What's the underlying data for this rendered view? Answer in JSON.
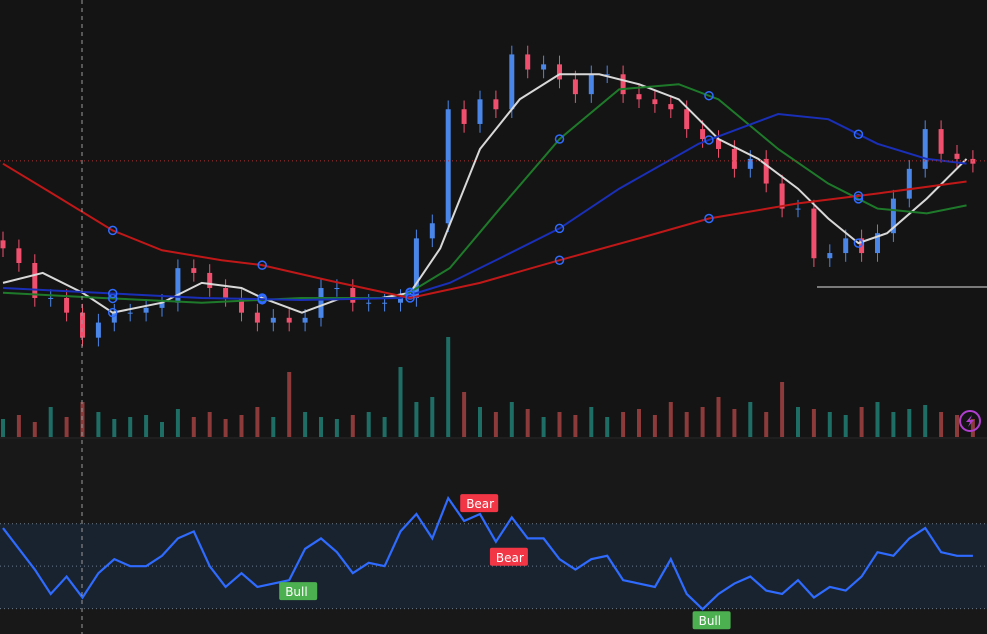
{
  "chart_data": {
    "type": "candlestick",
    "title": "",
    "price_ylim": [
      45,
      155
    ],
    "price_reference_line": 114.5,
    "closes": [
      92.5,
      88.8,
      80,
      80,
      76.3,
      70,
      73.8,
      76.3,
      76.3,
      77.5,
      78.8,
      87.5,
      86.3,
      82.5,
      80,
      76.3,
      73.8,
      75,
      73.8,
      75,
      82.5,
      82.5,
      78.8,
      78.8,
      78.8,
      80,
      95,
      98.8,
      127.5,
      123.8,
      130,
      127.5,
      141.3,
      137.5,
      138.8,
      135,
      131.3,
      136.3,
      136.3,
      131.3,
      130,
      128.8,
      127.5,
      122.5,
      120,
      117.5,
      112.5,
      115,
      108.8,
      102.5,
      102.5,
      90,
      91.3,
      95,
      91.3,
      96.3,
      105,
      112.5,
      122.5,
      116.3,
      115,
      113.8
    ],
    "volume": [
      18,
      22,
      15,
      30,
      20,
      35,
      25,
      18,
      20,
      22,
      15,
      28,
      20,
      25,
      18,
      22,
      30,
      20,
      65,
      25,
      20,
      18,
      22,
      25,
      20,
      70,
      35,
      40,
      100,
      45,
      30,
      25,
      35,
      28,
      20,
      25,
      22,
      30,
      20,
      25,
      28,
      22,
      35,
      25,
      30,
      40,
      28,
      35,
      25,
      55,
      30,
      28,
      25,
      22,
      30,
      35,
      25,
      28,
      32,
      25,
      22,
      18
    ],
    "volume_ylim": [
      0,
      100
    ],
    "moving_averages": [
      {
        "name": "MA fast",
        "color": "#d8d8d8",
        "x": [
          0,
          2.5,
          5,
          6.9,
          10,
          12.5,
          15,
          16.3,
          18.8,
          21.3,
          23.8,
          25.6,
          27.5,
          30,
          32.5,
          35,
          37.5,
          40,
          42.5,
          45,
          47.5,
          50,
          51.9,
          53.8,
          55.6,
          58.1,
          60.6
        ],
        "y": [
          83.8,
          86.3,
          81.3,
          76.3,
          78.8,
          83.8,
          82.5,
          80,
          76.3,
          80,
          80,
          81.3,
          92.5,
          117.5,
          130,
          136.3,
          136.3,
          133.8,
          130,
          120,
          115,
          107.5,
          100,
          93.8,
          96.3,
          105,
          115
        ],
        "markers": [
          6.9,
          16.3,
          25.6,
          53.8
        ]
      },
      {
        "name": "MA mid",
        "color": "#1e7a2a",
        "x": [
          0,
          6.25,
          12.5,
          18.75,
          25,
          28.1,
          31.25,
          35,
          38.75,
          42.5,
          45,
          48.75,
          51.9,
          55,
          58.1,
          60.6
        ],
        "y": [
          81.3,
          80,
          78.8,
          80,
          80,
          87.5,
          102.5,
          120,
          132.5,
          133.8,
          130,
          117.5,
          108.8,
          102.5,
          101.3,
          103.3
        ],
        "markers": [
          6.9,
          16.3,
          25.6,
          35,
          44.4,
          53.8
        ]
      },
      {
        "name": "MA slow",
        "color": "#1a2fb8",
        "x": [
          0,
          12.5,
          18.75,
          25,
          28.1,
          31.25,
          35,
          38.75,
          43.75,
          48.75,
          51.9,
          55,
          58.1,
          60.6
        ],
        "y": [
          82.5,
          80,
          79.5,
          80,
          83.8,
          90,
          97.5,
          107.5,
          118.8,
          126.3,
          125,
          118.8,
          115,
          113.8
        ],
        "markers": [
          6.9,
          16.3,
          25.6,
          35,
          44.4,
          53.8
        ]
      },
      {
        "name": "MA long",
        "color": "#c01818",
        "x": [
          0,
          3.1,
          6.9,
          10,
          13.75,
          16.25,
          20.6,
          25.6,
          30,
          35,
          40,
          44.4,
          50,
          55,
          60.6
        ],
        "y": [
          113.8,
          106.3,
          97,
          92,
          89.5,
          88.3,
          84.3,
          80,
          83.8,
          89.5,
          95,
          100,
          103.8,
          106.3,
          109.3
        ],
        "markers": [
          6.9,
          16.3,
          25.6,
          35,
          44.4,
          53.8
        ]
      }
    ],
    "oscillator": {
      "ylim": [
        18,
        110
      ],
      "levels": [
        70,
        50,
        30
      ],
      "color": "#2f6bff",
      "values": [
        68,
        58.2,
        48.4,
        36.9,
        45.1,
        35.2,
        46.7,
        53.3,
        50,
        50,
        54.9,
        63.1,
        66.4,
        50,
        40.2,
        46.7,
        40.2,
        41.8,
        43.4,
        58.2,
        63.1,
        56.6,
        46.7,
        51.6,
        50,
        66.4,
        74.6,
        63.1,
        82.1,
        71.3,
        74.6,
        61.5,
        73,
        63.1,
        63.1,
        53.3,
        48.4,
        53.3,
        54.9,
        43.4,
        41.8,
        40.2,
        53.3,
        36.9,
        29.7,
        36.9,
        41.8,
        45.1,
        38.5,
        36.9,
        43.4,
        35.2,
        40.2,
        38.5,
        45.1,
        56.6,
        54.9,
        63.1,
        68,
        56.6,
        54.9,
        54.9
      ],
      "signals": [
        {
          "label": "Bear",
          "index": 28,
          "type": "bear"
        },
        {
          "label": "Bear",
          "index": 31,
          "type": "bear"
        },
        {
          "label": "Bull",
          "index": 18,
          "type": "bull"
        },
        {
          "label": "Bull",
          "index": 44,
          "type": "bull"
        }
      ]
    },
    "colors": {
      "up": "#4a86e8",
      "down": "#f0506e",
      "vol_up": "#1f6e66",
      "vol_down": "#8c3a3a",
      "bear": "#f23645",
      "bull": "#4caf50",
      "accent": "#b03fd0"
    }
  },
  "toolbar": {
    "bolt_icon": "lightning-icon"
  }
}
